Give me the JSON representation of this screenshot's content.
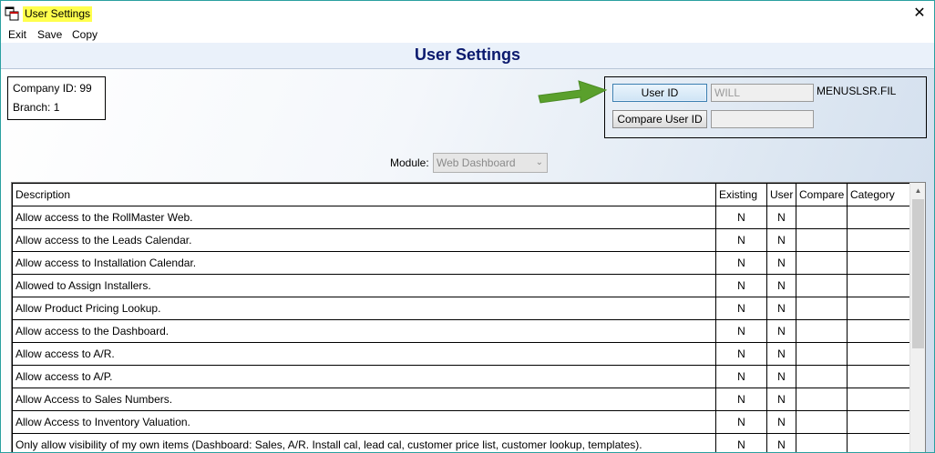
{
  "window": {
    "title": "User Settings",
    "close_glyph": "✕"
  },
  "menu": [
    {
      "label": "Exit"
    },
    {
      "label": "Save"
    },
    {
      "label": "Copy"
    }
  ],
  "header": {
    "title": "User Settings"
  },
  "company": {
    "company_id_text": "Company ID: 99",
    "branch_text": "Branch: 1"
  },
  "user": {
    "user_id_button": "User ID",
    "user_id_value": "WILL",
    "compare_button": "Compare User ID",
    "compare_value": "",
    "file_label": "MENUSLSR.FIL"
  },
  "module": {
    "label": "Module:",
    "selected": "Web Dashboard"
  },
  "table": {
    "columns": [
      "Description",
      "Existing",
      "User",
      "Compare",
      "Category"
    ],
    "rows": [
      {
        "description": "Allow access to the RollMaster Web.",
        "existing": "N",
        "user": "N",
        "compare": "",
        "category": ""
      },
      {
        "description": "Allow access to the Leads Calendar.",
        "existing": "N",
        "user": "N",
        "compare": "",
        "category": ""
      },
      {
        "description": "Allow access to Installation Calendar.",
        "existing": "N",
        "user": "N",
        "compare": "",
        "category": ""
      },
      {
        "description": "Allowed to Assign Installers.",
        "existing": "N",
        "user": "N",
        "compare": "",
        "category": ""
      },
      {
        "description": "Allow Product Pricing Lookup.",
        "existing": "N",
        "user": "N",
        "compare": "",
        "category": ""
      },
      {
        "description": "Allow access to the Dashboard.",
        "existing": "N",
        "user": "N",
        "compare": "",
        "category": ""
      },
      {
        "description": "Allow access to A/R.",
        "existing": "N",
        "user": "N",
        "compare": "",
        "category": ""
      },
      {
        "description": "Allow access to A/P.",
        "existing": "N",
        "user": "N",
        "compare": "",
        "category": ""
      },
      {
        "description": "Allow Access to Sales Numbers.",
        "existing": "N",
        "user": "N",
        "compare": "",
        "category": ""
      },
      {
        "description": "Allow Access to Inventory Valuation.",
        "existing": "N",
        "user": "N",
        "compare": "",
        "category": ""
      },
      {
        "description": "Only allow visibility of my own items (Dashboard: Sales, A/R. Install cal, lead cal, customer price list, customer lookup, templates).",
        "existing": "N",
        "user": "N",
        "compare": "",
        "category": ""
      }
    ]
  },
  "colors": {
    "title_highlight": "#ffff4d",
    "header_title": "#0b1a6e",
    "arrow": "#5aa02c"
  },
  "icons": {
    "app": "app-window-icon",
    "close": "close-icon",
    "arrow": "arrow-right-icon"
  }
}
